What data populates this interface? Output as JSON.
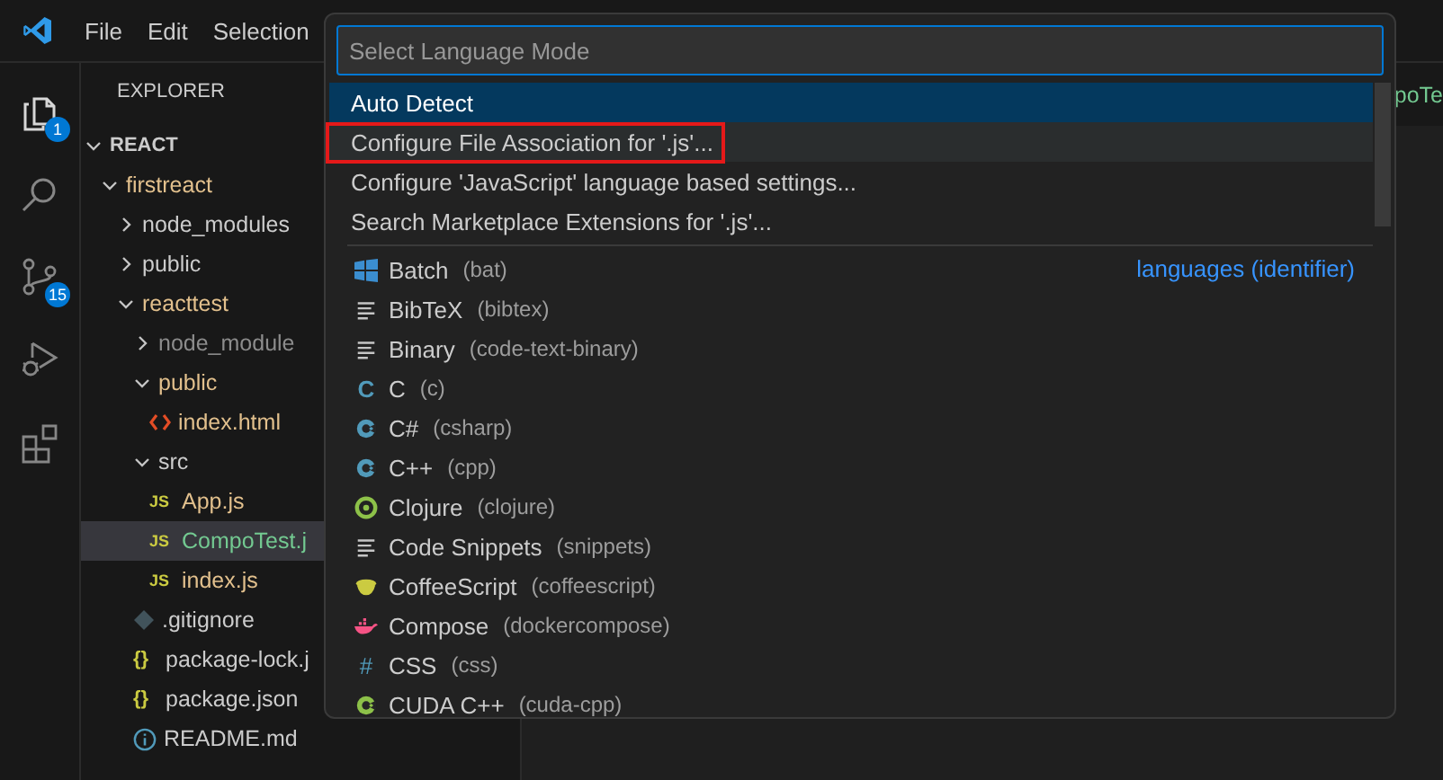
{
  "menu_bar": {
    "items": [
      "File",
      "Edit",
      "Selection"
    ]
  },
  "activity_bar": [
    {
      "kind": "files",
      "badge": "1",
      "selected": true
    },
    {
      "kind": "search",
      "selected": false
    },
    {
      "kind": "source-control",
      "badge": "15",
      "selected": false
    },
    {
      "kind": "run-debug",
      "selected": false
    },
    {
      "kind": "extensions",
      "selected": false
    }
  ],
  "sidebar": {
    "title": "EXPLORER",
    "tree": [
      {
        "label": "REACT",
        "kind": "folder",
        "expanded": true,
        "bold": true,
        "children": [
          {
            "label": "firstreact",
            "kind": "folder",
            "expanded": true,
            "color": "#e2c08d",
            "children": [
              {
                "label": "node_modules",
                "kind": "folder",
                "expanded": false,
                "color": "#cccccc"
              },
              {
                "label": "public",
                "kind": "folder",
                "expanded": false,
                "color": "#cccccc"
              },
              {
                "label": "reacttest",
                "kind": "folder",
                "expanded": true,
                "color": "#e2c08d",
                "children": [
                  {
                    "label": "node_module",
                    "kind": "folder",
                    "expanded": false,
                    "color": "#8c8c8c"
                  },
                  {
                    "label": "public",
                    "kind": "folder",
                    "expanded": true,
                    "color": "#e2c08d",
                    "children": [
                      {
                        "label": "index.html",
                        "kind": "html",
                        "color": "#e2c08d"
                      }
                    ]
                  },
                  {
                    "label": "src",
                    "kind": "folder",
                    "expanded": true,
                    "color": "#cccccc",
                    "children": [
                      {
                        "label": "App.js",
                        "kind": "js",
                        "icon": "JS",
                        "color": "#e2c08d",
                        "selected": false
                      },
                      {
                        "label": "CompoTest.j",
                        "kind": "js",
                        "icon": "JS",
                        "color": "#73c991",
                        "selected": true
                      },
                      {
                        "label": "index.js",
                        "kind": "js",
                        "icon": "JS",
                        "color": "#e2c08d",
                        "selected": false
                      }
                    ]
                  },
                  {
                    "label": ".gitignore",
                    "kind": "git",
                    "color": "#cccccc"
                  },
                  {
                    "label": "package-lock.j",
                    "kind": "json",
                    "icon": "{}",
                    "color": "#cccccc"
                  },
                  {
                    "label": "package.json",
                    "kind": "json",
                    "icon": "{}",
                    "color": "#cccccc"
                  },
                  {
                    "label": "README.md",
                    "kind": "info",
                    "color": "#cccccc"
                  }
                ]
              }
            ]
          }
        ]
      }
    ]
  },
  "editor": {
    "tab": "poTe"
  },
  "quick_pick": {
    "placeholder": "Select Language Mode",
    "actions": [
      {
        "label": "Auto Detect",
        "selected": true,
        "hovered": false,
        "annotated": false
      },
      {
        "label": "Configure File Association for '.js'...",
        "selected": false,
        "hovered": true,
        "annotated": true
      },
      {
        "label": "Configure 'JavaScript' language based settings...",
        "selected": false,
        "hovered": false,
        "annotated": false
      },
      {
        "label": "Search Marketplace Extensions for '.js'...",
        "selected": false,
        "hovered": false,
        "annotated": false
      }
    ],
    "group_label": "languages (identifier)",
    "languages": [
      {
        "name": "Batch",
        "id": "(bat)",
        "kind": "windows"
      },
      {
        "name": "BibTeX",
        "id": "(bibtex)",
        "kind": "lines"
      },
      {
        "name": "Binary",
        "id": "(code-text-binary)",
        "kind": "lines"
      },
      {
        "name": "C",
        "id": "(c)",
        "kind": "c",
        "icon": "C"
      },
      {
        "name": "C#",
        "id": "(csharp)",
        "kind": "csharp"
      },
      {
        "name": "C++",
        "id": "(cpp)",
        "kind": "cpp"
      },
      {
        "name": "Clojure",
        "id": "(clojure)",
        "kind": "clojure"
      },
      {
        "name": "Code Snippets",
        "id": "(snippets)",
        "kind": "lines"
      },
      {
        "name": "CoffeeScript",
        "id": "(coffeescript)",
        "kind": "coffee"
      },
      {
        "name": "Compose",
        "id": "(dockercompose)",
        "kind": "docker"
      },
      {
        "name": "CSS",
        "id": "(css)",
        "kind": "hash",
        "icon": "#"
      },
      {
        "name": "CUDA C++",
        "id": "(cuda-cpp)",
        "kind": "cuda"
      }
    ]
  }
}
